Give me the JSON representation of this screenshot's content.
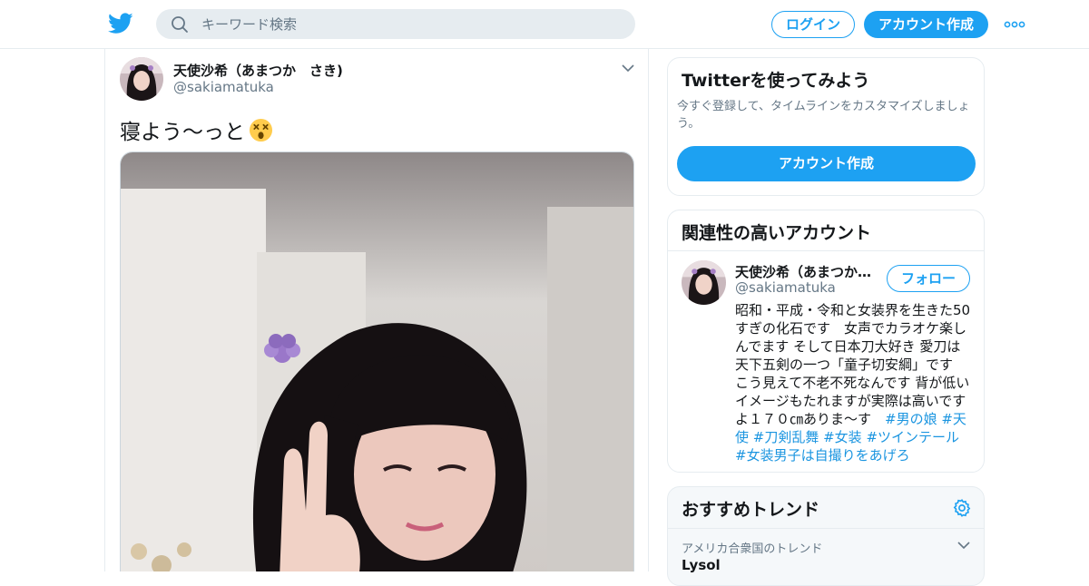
{
  "header": {
    "search_placeholder": "キーワード検索",
    "login_label": "ログイン",
    "signup_label": "アカウント作成"
  },
  "tweet": {
    "author_name": "天使沙希（あまつか　さき)",
    "author_handle": "@sakiamatuka",
    "text": "寝よう～っと",
    "emoji": "dizzy-face"
  },
  "sidebar": {
    "try_card": {
      "title": "Twitterを使ってみよう",
      "description": "今すぐ登録して、タイムラインをカスタマイズしましょう。",
      "cta_label": "アカウント作成"
    },
    "related": {
      "title": "関連性の高いアカウント",
      "account": {
        "name": "天使沙希（あまつか…",
        "handle": "@sakiamatuka",
        "follow_label": "フォロー",
        "bio": "昭和・平成・令和と女装界を生きた50すぎの化石です　女声でカラオケ楽しんでます そして日本刀大好き 愛刀は天下五剣の一つ「童子切安綱」です　こう見えて不老不死なんです 背が低いイメージもたれますが実際は高いですよ１７０㎝ありま～す　",
        "hashtags": "#男の娘 #天使 #刀剣乱舞 #女装 #ツインテール #女装男子は自撮りをあげろ"
      }
    },
    "trends": {
      "title": "おすすめトレンド",
      "items": [
        {
          "location": "アメリカ合衆国のトレンド",
          "name": "Lysol"
        }
      ]
    }
  },
  "colors": {
    "brand": "#1da1f2",
    "link": "#1b95e0",
    "secondary_text": "#657786",
    "border": "#e6ecf0"
  }
}
